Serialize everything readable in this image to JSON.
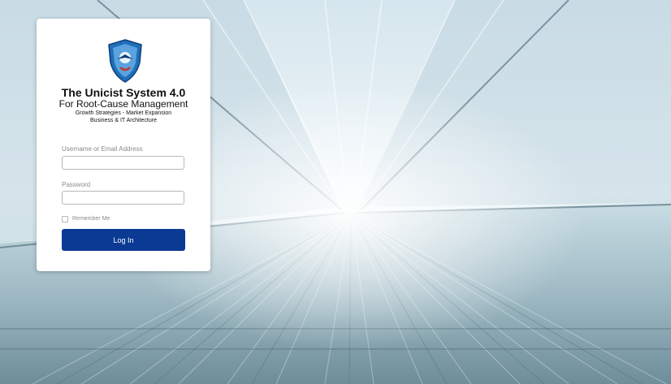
{
  "login": {
    "title": "The Unicist System 4.0",
    "subtitle": "For Root-Cause Management",
    "tagline_1": "Growth Strategies - Market Expansion",
    "tagline_2": "Business & IT Architecture",
    "username_label": "Username or Email Address",
    "username_value": "",
    "password_label": "Password",
    "password_value": "",
    "remember_label": "Remember Me",
    "remember_checked": false,
    "login_button": "Log In",
    "logo_text": "The Unicist System",
    "button_color": "#0b3a94"
  }
}
